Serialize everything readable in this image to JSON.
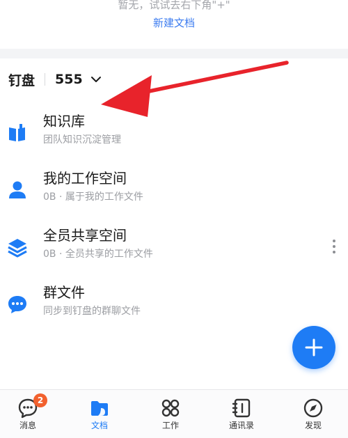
{
  "empty_state": {
    "hint": "暂无，试试去右下角\"+\"",
    "new_doc_link": "新建文档"
  },
  "drive": {
    "title": "钉盘",
    "org": "555"
  },
  "items": [
    {
      "title": "知识库",
      "subtitle": "团队知识沉淀管理",
      "icon": "book-icon"
    },
    {
      "title": "我的工作空间",
      "subtitle": "0B · 属于我的工作文件",
      "icon": "person-icon"
    },
    {
      "title": "全员共享空间",
      "subtitle": "0B · 全员共享的工作文件",
      "icon": "layers-icon"
    },
    {
      "title": "群文件",
      "subtitle": "同步到钉盘的群聊文件",
      "icon": "chat-bubble-icon"
    }
  ],
  "tabs": [
    {
      "label": "消息",
      "icon": "message-icon",
      "badge": "2"
    },
    {
      "label": "文档",
      "icon": "document-folder-icon",
      "active": true
    },
    {
      "label": "工作",
      "icon": "grid-icon"
    },
    {
      "label": "通讯录",
      "icon": "contacts-icon"
    },
    {
      "label": "发现",
      "icon": "compass-icon"
    }
  ],
  "colors": {
    "accent": "#1e7cf5",
    "badge": "#f2612e",
    "annotation_arrow": "#e8232b"
  }
}
